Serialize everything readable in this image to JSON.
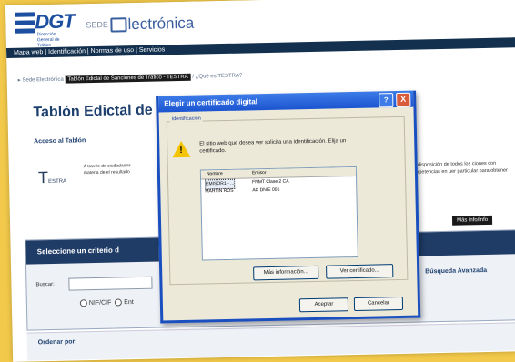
{
  "header": {
    "logo_text": "DGT",
    "logo_sub": "Dirección General de Tráfico",
    "sede_prefix": "SEDE",
    "sede_main": "lectrónica"
  },
  "menu": {
    "text": "Mapa web | Identificación | Normas de uso | Servicios"
  },
  "breadcrumb": {
    "home": "Sede Electrónica",
    "highlight": "Tablón Edictal de Sanciones de Tráfico - TESTRA",
    "rest": "/ ¿Qué es TESTRA?"
  },
  "page": {
    "title": "Tablón Edictal de",
    "acceso": "Acceso al Tablón",
    "logo": "T",
    "logo_small": "ESTRA",
    "left_desc": "A través de ciudadanos materia de el resultado",
    "right_desc": "e a disposición de todos los ciones con competencias en uer particular para obtener",
    "mas_info": "Más info/info"
  },
  "criteria": {
    "header": "Seleccione un criterio d",
    "buscar_label": "Buscar:",
    "radio_1": "NIF/CIF",
    "radio_2": "Ent",
    "busqueda_avanzada": "Búsqueda Avanzada"
  },
  "ordenar": {
    "label": "Ordenar por:"
  },
  "dialog": {
    "title": "Elegir un certificado digital",
    "help": "?",
    "close": "X",
    "group_label": "Identificación",
    "message": "El sitio web que desea ver solicita una identificación. Elija un certificado.",
    "columns": [
      "Nombre",
      "Emisor"
    ],
    "rows": [
      {
        "name": "EMISOR1 - ...",
        "issuer": "FNMT Clase 2 CA"
      },
      {
        "name": "MARTIN ROS",
        "issuer": "AC DNIE 001"
      }
    ],
    "more_info": "Más información...",
    "view_cert": "Ver certificado...",
    "accept": "Aceptar",
    "cancel": "Cancelar"
  },
  "colors": {
    "brand": "#1d4fa0",
    "menu_bg": "#13304f",
    "dialog_title": "#1c55d0",
    "page_bg": "#f2c94a"
  }
}
